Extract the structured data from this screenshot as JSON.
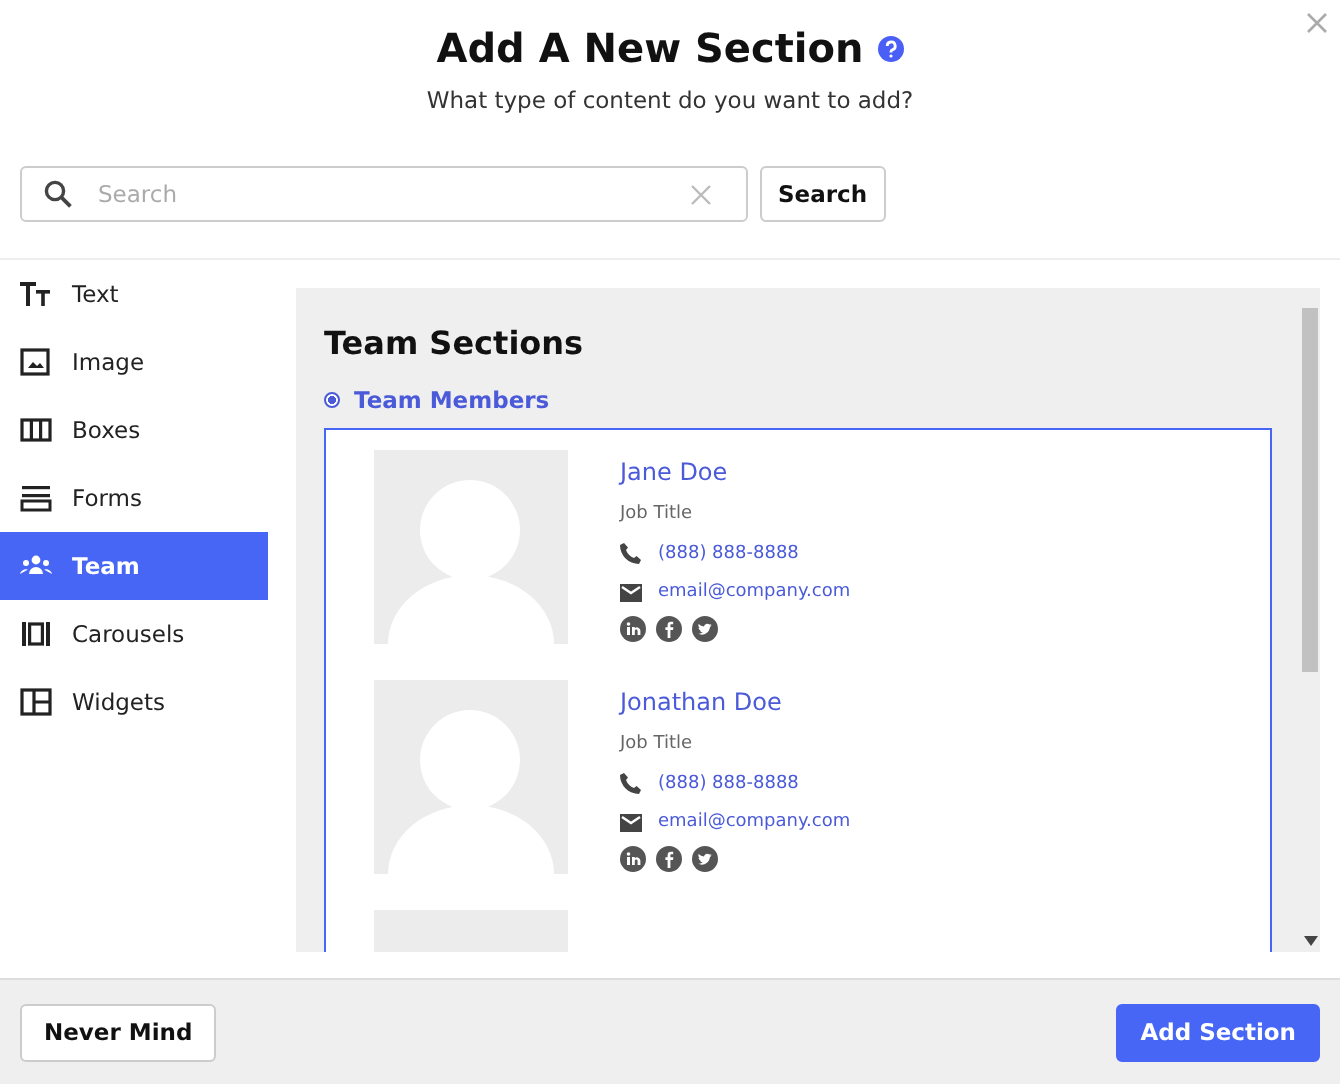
{
  "dialog": {
    "title": "Add A New Section",
    "subtitle": "What type of content do you want to add?"
  },
  "search": {
    "placeholder": "Search",
    "button": "Search"
  },
  "sidebar": {
    "items": [
      {
        "kind": "text",
        "label": "Text",
        "selected": false
      },
      {
        "kind": "image",
        "label": "Image",
        "selected": false
      },
      {
        "kind": "boxes",
        "label": "Boxes",
        "selected": false
      },
      {
        "kind": "forms",
        "label": "Forms",
        "selected": false
      },
      {
        "kind": "team",
        "label": "Team",
        "selected": true
      },
      {
        "kind": "carousels",
        "label": "Carousels",
        "selected": false
      },
      {
        "kind": "widgets",
        "label": "Widgets",
        "selected": false
      }
    ]
  },
  "content": {
    "heading": "Team Sections",
    "options": [
      {
        "label": "Team Members",
        "selected": true
      }
    ],
    "members": [
      {
        "name": "Jane Doe",
        "job_title": "Job Title",
        "phone": "(888) 888-8888",
        "email": "email@company.com"
      },
      {
        "name": "Jonathan Doe",
        "job_title": "Job Title",
        "phone": "(888) 888-8888",
        "email": "email@company.com"
      }
    ]
  },
  "footer": {
    "cancel": "Never Mind",
    "confirm": "Add Section"
  }
}
